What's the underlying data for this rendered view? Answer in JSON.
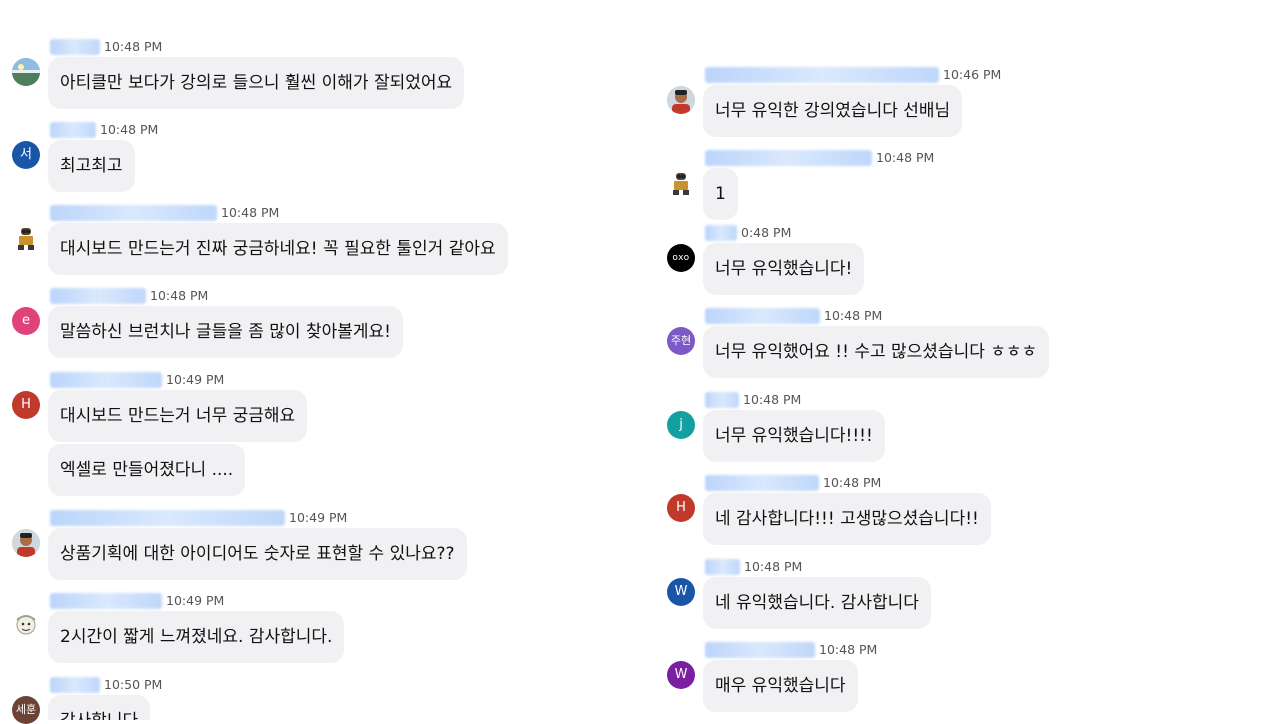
{
  "chat": {
    "left": [
      {
        "time": "10:48 PM",
        "text": "아티클만 보다가 강의로 들으니 훨씬 이해가 잘되었어요",
        "avatar_icon": "landscape-avatar-icon"
      },
      {
        "time": "10:48 PM",
        "text": "최고최고",
        "initial": "서",
        "color": "#1a56a8"
      },
      {
        "time": "10:48 PM",
        "text": "대시보드 만드는거 진짜 궁금하네요! 꼭 필요한 툴인거 같아요",
        "avatar_icon": "robot-avatar-icon"
      },
      {
        "time": "10:48 PM",
        "text": "말씀하신 브런치나 글들을 좀 많이 찾아볼게요!",
        "initial": "e",
        "color": "#e0427a"
      },
      {
        "time": "10:49 PM",
        "text": "대시보드 만드는거 너무 궁금해요",
        "text2": "엑셀로 만들어졌다니 ....",
        "initial": "H",
        "color": "#c0392b"
      },
      {
        "time": "10:49 PM",
        "text": "상품기획에 대한 아이디어도 숫자로 표현할 수 있나요??",
        "avatar_icon": "person-photo-avatar-icon"
      },
      {
        "time": "10:49 PM",
        "text": "2시간이 짧게 느껴졌네요. 감사합니다.",
        "avatar_icon": "cartoon-avatar-icon"
      },
      {
        "time": "10:50 PM",
        "text": "감사합니다",
        "initial": "세훈",
        "color": "#6b4436"
      }
    ],
    "right": [
      {
        "time": "10:46 PM",
        "text": "너무 유익한 강의였습니다 선배님",
        "avatar_icon": "person-photo-avatar-icon"
      },
      {
        "time": "10:48 PM",
        "text": "1",
        "avatar_icon": "robot-avatar-icon"
      },
      {
        "time": "0:48 PM",
        "text": "너무 유익했습니다!",
        "initial": "oxo",
        "color": "#000000"
      },
      {
        "time": "10:48 PM",
        "text": "너무 유익했어요 !! 수고 많으셨습니다 ㅎㅎㅎ",
        "initial": "주현",
        "color": "#7b59c7"
      },
      {
        "time": "10:48 PM",
        "text": "너무 유익했습니다!!!!",
        "initial": "j",
        "color": "#12a0a0"
      },
      {
        "time": "10:48 PM",
        "text": "네 감사합니다!!! 고생많으셨습니다!!",
        "initial": "H",
        "color": "#c0392b"
      },
      {
        "time": "10:48 PM",
        "text": "네 유익했습니다. 감사합니다",
        "initial": "W",
        "color": "#1a56a8"
      },
      {
        "time": "10:48 PM",
        "text": "매우 유익했습니다",
        "initial": "W",
        "color": "#7a1fa2"
      }
    ]
  }
}
